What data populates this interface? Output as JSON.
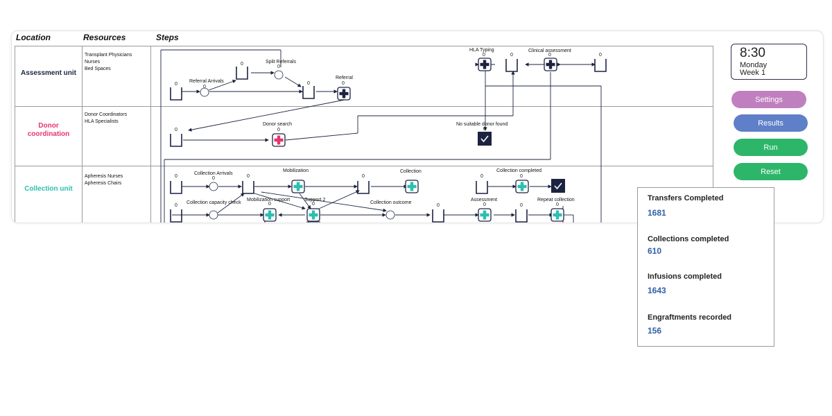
{
  "colors": {
    "assessment": "#1c2340",
    "donor": "#e8336e",
    "collection": "#2bbfb0",
    "settings": "#c07fbf",
    "results": "#5f80c8",
    "run": "#2db66a",
    "reset": "#2db66a",
    "stat_value": "#2e5fa6"
  },
  "headers": {
    "location": "Location",
    "resources": "Resources",
    "steps": "Steps"
  },
  "rows": [
    {
      "location": "Assessment unit",
      "resources": [
        "Transplant Physicians",
        "Nurses",
        "Bed Spaces"
      ]
    },
    {
      "location": "Donor coordination",
      "resources": [
        "Donor Coordinators",
        "HLA Specialists"
      ]
    },
    {
      "location": "Collection unit",
      "resources": [
        "Apheresis Nurses",
        "Apheresis Chairs"
      ]
    }
  ],
  "step_labels": {
    "referral_arrivals": "Referral Arrivals",
    "split_referrals": "Split Referrals",
    "referral": "Referral",
    "hla_typing": "HLA Typing",
    "clinical_assessment": "Clinical assessment",
    "donor_search": "Donor search",
    "no_suitable_donor": "No suitable donor found",
    "collection_arrivals": "Collection  Arrivals",
    "mobilization": "Mobilization",
    "collection": "Collection",
    "collection_completed": "Collection completed",
    "collection_capacity_check": "Collection capacity check",
    "mobilization_support": "Mobilization support",
    "support_2": "Support 2",
    "collection_outcome": "Collection outcome",
    "assessment": "Assessment",
    "repeat_collection": "Repeat collection"
  },
  "queue_count": "0",
  "clock": {
    "time": "8:30",
    "day": "Monday",
    "week": "Week 1"
  },
  "buttons": {
    "settings": "Settings",
    "results": "Results",
    "run": "Run",
    "reset": "Reset"
  },
  "stats": [
    {
      "label": "Transfers Completed",
      "value": "1681"
    },
    {
      "label": "Collections completed",
      "value": "610"
    },
    {
      "label": "Infusions completed",
      "value": "1643"
    },
    {
      "label": "Engraftments recorded",
      "value": "156"
    }
  ]
}
